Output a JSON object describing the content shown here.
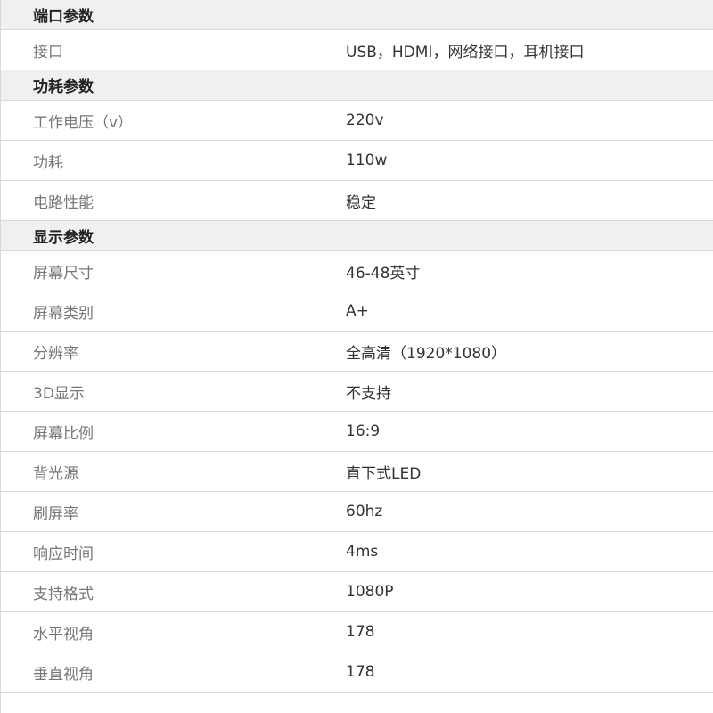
{
  "sections": [
    {
      "title": "端口参数",
      "rows": [
        {
          "label": "接口",
          "value": "USB，HDMI，网络接口，耳机接口"
        }
      ]
    },
    {
      "title": "功耗参数",
      "rows": [
        {
          "label": "工作电压（v）",
          "value": "220v"
        },
        {
          "label": "功耗",
          "value": "110w"
        },
        {
          "label": "电路性能",
          "value": "稳定"
        }
      ]
    },
    {
      "title": "显示参数",
      "rows": [
        {
          "label": "屏幕尺寸",
          "value": "46-48英寸"
        },
        {
          "label": "屏幕类别",
          "value": "A+"
        },
        {
          "label": "分辨率",
          "value": "全高清（1920*1080）"
        },
        {
          "label": "3D显示",
          "value": "不支持"
        },
        {
          "label": "屏幕比例",
          "value": "16:9"
        },
        {
          "label": "背光源",
          "value": "直下式LED"
        },
        {
          "label": "刷屏率",
          "value": "60hz"
        },
        {
          "label": "响应时间",
          "value": "4ms"
        },
        {
          "label": "支持格式",
          "value": "1080P"
        },
        {
          "label": "水平视角",
          "value": "178"
        },
        {
          "label": "垂直视角",
          "value": "178"
        }
      ]
    }
  ]
}
